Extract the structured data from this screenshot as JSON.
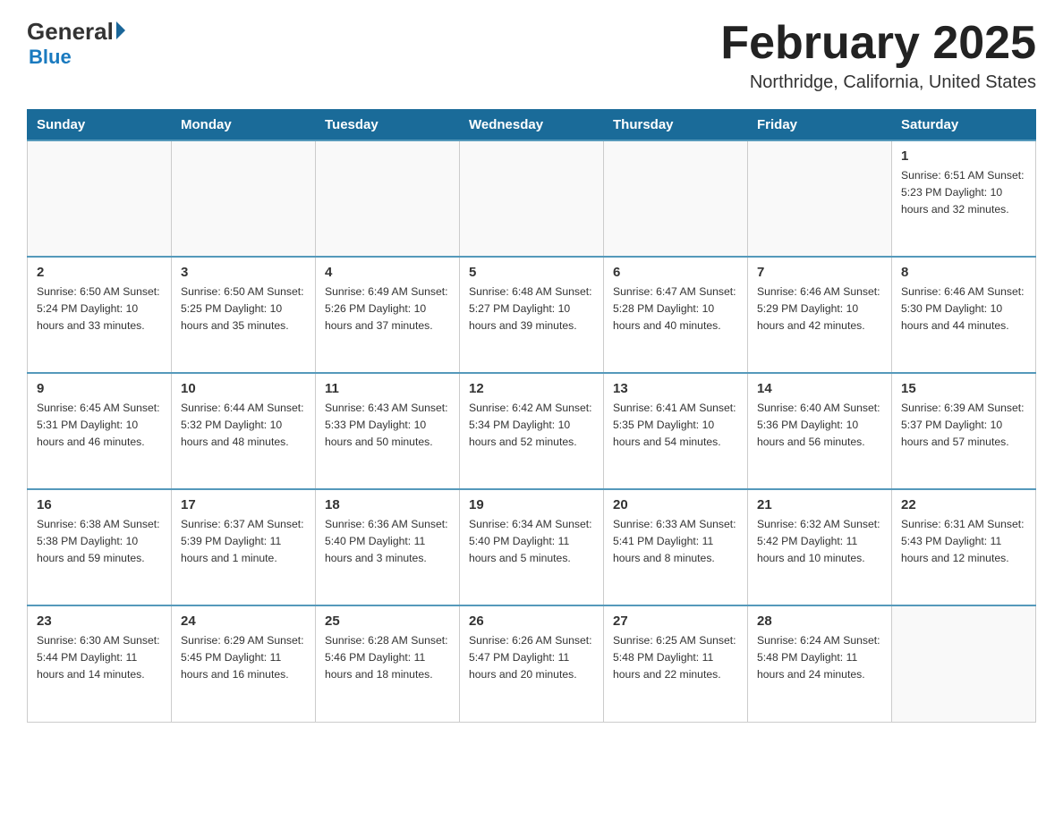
{
  "header": {
    "logo_general": "General",
    "logo_blue": "Blue",
    "main_title": "February 2025",
    "subtitle": "Northridge, California, United States"
  },
  "days_of_week": [
    "Sunday",
    "Monday",
    "Tuesday",
    "Wednesday",
    "Thursday",
    "Friday",
    "Saturday"
  ],
  "weeks": [
    [
      {
        "day": "",
        "info": ""
      },
      {
        "day": "",
        "info": ""
      },
      {
        "day": "",
        "info": ""
      },
      {
        "day": "",
        "info": ""
      },
      {
        "day": "",
        "info": ""
      },
      {
        "day": "",
        "info": ""
      },
      {
        "day": "1",
        "info": "Sunrise: 6:51 AM\nSunset: 5:23 PM\nDaylight: 10 hours and 32 minutes."
      }
    ],
    [
      {
        "day": "2",
        "info": "Sunrise: 6:50 AM\nSunset: 5:24 PM\nDaylight: 10 hours and 33 minutes."
      },
      {
        "day": "3",
        "info": "Sunrise: 6:50 AM\nSunset: 5:25 PM\nDaylight: 10 hours and 35 minutes."
      },
      {
        "day": "4",
        "info": "Sunrise: 6:49 AM\nSunset: 5:26 PM\nDaylight: 10 hours and 37 minutes."
      },
      {
        "day": "5",
        "info": "Sunrise: 6:48 AM\nSunset: 5:27 PM\nDaylight: 10 hours and 39 minutes."
      },
      {
        "day": "6",
        "info": "Sunrise: 6:47 AM\nSunset: 5:28 PM\nDaylight: 10 hours and 40 minutes."
      },
      {
        "day": "7",
        "info": "Sunrise: 6:46 AM\nSunset: 5:29 PM\nDaylight: 10 hours and 42 minutes."
      },
      {
        "day": "8",
        "info": "Sunrise: 6:46 AM\nSunset: 5:30 PM\nDaylight: 10 hours and 44 minutes."
      }
    ],
    [
      {
        "day": "9",
        "info": "Sunrise: 6:45 AM\nSunset: 5:31 PM\nDaylight: 10 hours and 46 minutes."
      },
      {
        "day": "10",
        "info": "Sunrise: 6:44 AM\nSunset: 5:32 PM\nDaylight: 10 hours and 48 minutes."
      },
      {
        "day": "11",
        "info": "Sunrise: 6:43 AM\nSunset: 5:33 PM\nDaylight: 10 hours and 50 minutes."
      },
      {
        "day": "12",
        "info": "Sunrise: 6:42 AM\nSunset: 5:34 PM\nDaylight: 10 hours and 52 minutes."
      },
      {
        "day": "13",
        "info": "Sunrise: 6:41 AM\nSunset: 5:35 PM\nDaylight: 10 hours and 54 minutes."
      },
      {
        "day": "14",
        "info": "Sunrise: 6:40 AM\nSunset: 5:36 PM\nDaylight: 10 hours and 56 minutes."
      },
      {
        "day": "15",
        "info": "Sunrise: 6:39 AM\nSunset: 5:37 PM\nDaylight: 10 hours and 57 minutes."
      }
    ],
    [
      {
        "day": "16",
        "info": "Sunrise: 6:38 AM\nSunset: 5:38 PM\nDaylight: 10 hours and 59 minutes."
      },
      {
        "day": "17",
        "info": "Sunrise: 6:37 AM\nSunset: 5:39 PM\nDaylight: 11 hours and 1 minute."
      },
      {
        "day": "18",
        "info": "Sunrise: 6:36 AM\nSunset: 5:40 PM\nDaylight: 11 hours and 3 minutes."
      },
      {
        "day": "19",
        "info": "Sunrise: 6:34 AM\nSunset: 5:40 PM\nDaylight: 11 hours and 5 minutes."
      },
      {
        "day": "20",
        "info": "Sunrise: 6:33 AM\nSunset: 5:41 PM\nDaylight: 11 hours and 8 minutes."
      },
      {
        "day": "21",
        "info": "Sunrise: 6:32 AM\nSunset: 5:42 PM\nDaylight: 11 hours and 10 minutes."
      },
      {
        "day": "22",
        "info": "Sunrise: 6:31 AM\nSunset: 5:43 PM\nDaylight: 11 hours and 12 minutes."
      }
    ],
    [
      {
        "day": "23",
        "info": "Sunrise: 6:30 AM\nSunset: 5:44 PM\nDaylight: 11 hours and 14 minutes."
      },
      {
        "day": "24",
        "info": "Sunrise: 6:29 AM\nSunset: 5:45 PM\nDaylight: 11 hours and 16 minutes."
      },
      {
        "day": "25",
        "info": "Sunrise: 6:28 AM\nSunset: 5:46 PM\nDaylight: 11 hours and 18 minutes."
      },
      {
        "day": "26",
        "info": "Sunrise: 6:26 AM\nSunset: 5:47 PM\nDaylight: 11 hours and 20 minutes."
      },
      {
        "day": "27",
        "info": "Sunrise: 6:25 AM\nSunset: 5:48 PM\nDaylight: 11 hours and 22 minutes."
      },
      {
        "day": "28",
        "info": "Sunrise: 6:24 AM\nSunset: 5:48 PM\nDaylight: 11 hours and 24 minutes."
      },
      {
        "day": "",
        "info": ""
      }
    ]
  ]
}
